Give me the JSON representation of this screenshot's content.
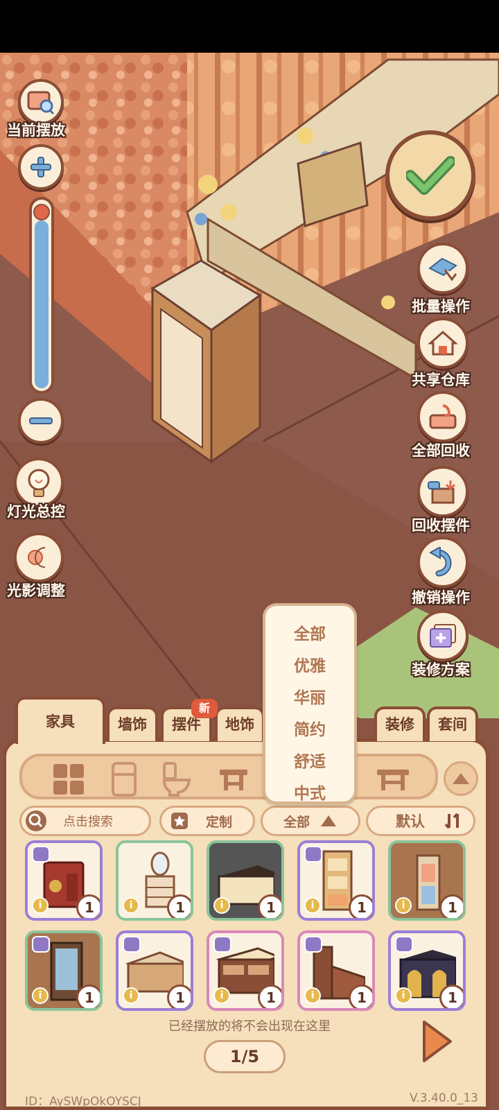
{
  "left_tools": {
    "current_placement": "当前摆放",
    "lighting_control": "灯光总控",
    "shadow_adjust": "光影调整"
  },
  "right_tools": {
    "batch": "批量操作",
    "shared_storage": "共享仓库",
    "recall_all": "全部回收",
    "recall_item": "回收摆件",
    "undo": "撤销操作",
    "plans": "装修方案"
  },
  "tabs": [
    "家具",
    "墙饰",
    "摆件",
    "地饰",
    "装修",
    "套间"
  ],
  "tab_badge": "新",
  "dropdown_options": [
    "全部",
    "优雅",
    "华丽",
    "简约",
    "舒适",
    "中式"
  ],
  "search": {
    "placeholder": "点击搜索"
  },
  "custom_label": "定制",
  "filter_label": "全部",
  "sort_label": "默认",
  "item_counts": [
    "1",
    "1",
    "1",
    "1",
    "1",
    "1",
    "1",
    "1",
    "1",
    "1"
  ],
  "info_glyph": "i",
  "hint": "已经摆放的将不会出现在这里",
  "page": "1/5",
  "player_id": "ID：AySWpOkOYSCJ",
  "version": "V.3.40.0_13"
}
